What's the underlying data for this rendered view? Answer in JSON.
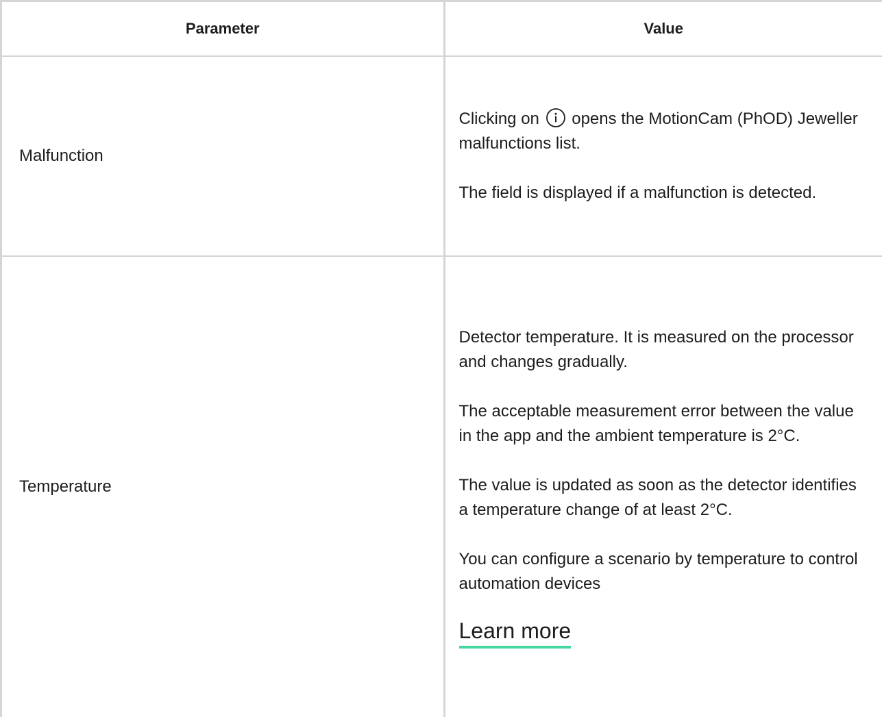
{
  "table": {
    "headers": {
      "parameter": "Parameter",
      "value": "Value"
    },
    "rows": [
      {
        "parameter": "Malfunction",
        "value": {
          "p1_before_icon": "Clicking on",
          "info_icon": "info-icon",
          "p1_after_icon": "opens the MotionCam (PhOD) Jeweller malfunctions list.",
          "p2": "The field is displayed if a malfunction is detected."
        }
      },
      {
        "parameter": "Temperature",
        "value": {
          "paragraphs": [
            "Detector temperature. It is measured on the processor and changes gradually.",
            "The acceptable measurement error between the value in the app and the ambient temperature is 2°C.",
            "The value is updated as soon as the detector identifies a temperature change of at least 2°C.",
            "You can configure a scenario by temperature to control automation devices"
          ],
          "link_label": "Learn more"
        }
      }
    ]
  },
  "colors": {
    "border": "#d5d5d5",
    "text": "#1d1d1d",
    "link_underline": "#46d6a0"
  }
}
